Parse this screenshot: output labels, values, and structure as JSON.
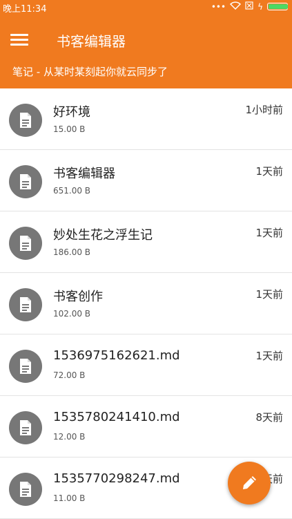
{
  "status_bar": {
    "time": "晚上11:34",
    "icons": [
      "dots-icon",
      "wifi-icon",
      "sim-icon",
      "charging-icon",
      "battery-icon"
    ],
    "battery_level": 1.0
  },
  "app_bar": {
    "title": "书客编辑器",
    "subtitle": "笔记 - 从某时某刻起你就云同步了",
    "menu_icon": "hamburger-menu-icon",
    "color": "#f07a1f"
  },
  "notes": [
    {
      "title": "好环境",
      "size": "15.00 B",
      "time": "1小时前"
    },
    {
      "title": "书客编辑器",
      "size": "651.00 B",
      "time": "1天前"
    },
    {
      "title": "妙处生花之浮生记",
      "size": "186.00 B",
      "time": "1天前"
    },
    {
      "title": "书客创作",
      "size": "102.00 B",
      "time": "1天前"
    },
    {
      "title": "1536975162621.md",
      "size": "72.00 B",
      "time": "1天前"
    },
    {
      "title": "1535780241410.md",
      "size": "12.00 B",
      "time": "8天前"
    },
    {
      "title": "1535770298247.md",
      "size": "11.00 B",
      "time": "8天前"
    }
  ],
  "fab": {
    "icon": "pencil-edit-icon"
  }
}
